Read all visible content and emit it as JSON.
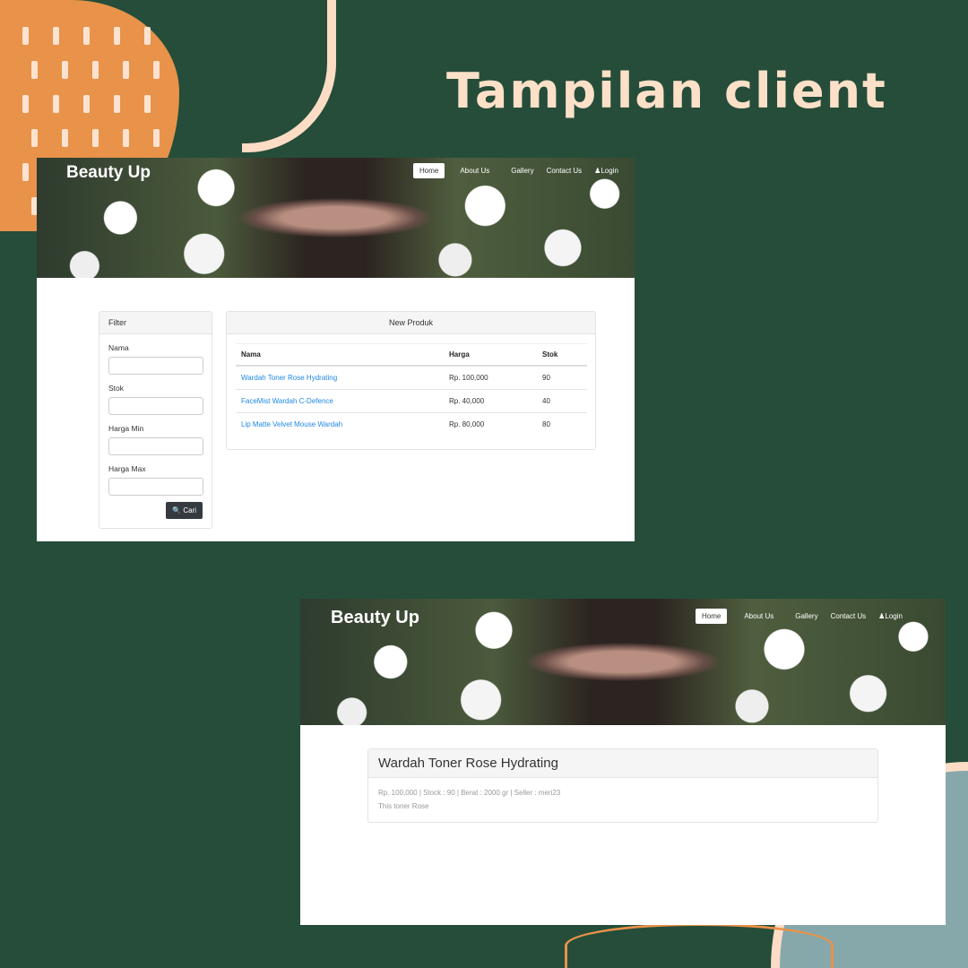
{
  "slide_title": "Tampilan client",
  "brand": "Beauty Up",
  "nav": [
    "Home",
    "About Us",
    "Gallery",
    "Contact Us",
    "Login"
  ],
  "filter": {
    "title": "Filter",
    "fields": [
      "Nama",
      "Stok",
      "Harga Min",
      "Harga Max"
    ],
    "button": "Cari"
  },
  "products": {
    "title": "New Produk",
    "headers": [
      "Nama",
      "Harga",
      "Stok"
    ],
    "rows": [
      [
        "Wardah Toner Rose Hydrating",
        "Rp. 100,000",
        "90"
      ],
      [
        "FaceMist Wardah C-Defence",
        "Rp. 40,000",
        "40"
      ],
      [
        "Lip Matte Velvet Mouse Wardah",
        "Rp. 80,000",
        "80"
      ]
    ]
  },
  "detail": {
    "title": "Wardah Toner Rose Hydrating",
    "meta": "Rp. 100,000 | Stock : 90 | Berat : 2000 gr | Seller : meri23",
    "desc": "This toner Rose"
  }
}
